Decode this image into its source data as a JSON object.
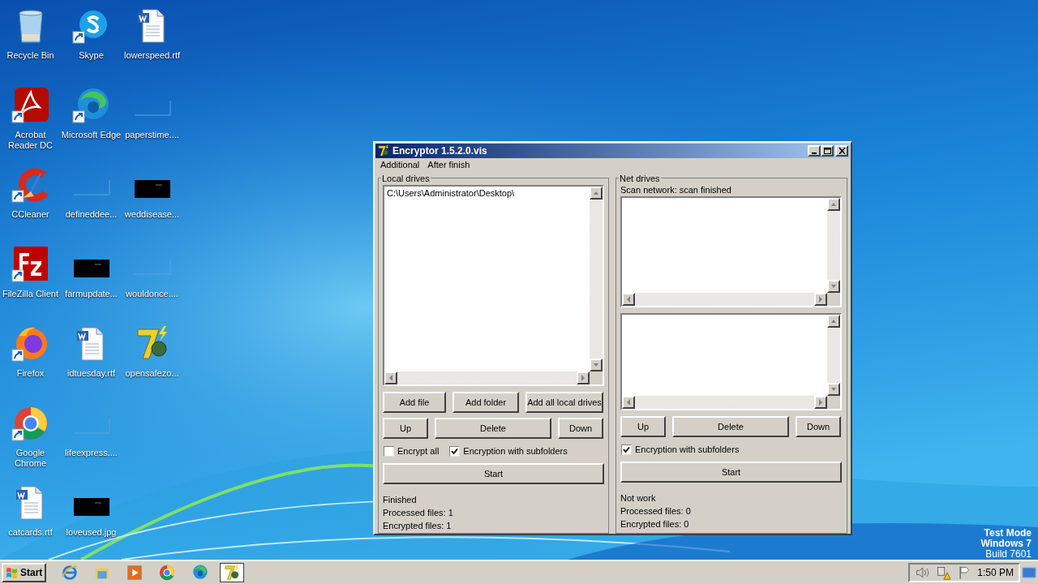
{
  "desktop_icons": [
    {
      "label": "Recycle Bin",
      "kind": "recycle",
      "shortcut": false
    },
    {
      "label": "Acrobat Reader DC",
      "kind": "acrobat",
      "shortcut": true
    },
    {
      "label": "CCleaner",
      "kind": "ccleaner",
      "shortcut": true
    },
    {
      "label": "FileZilla Client",
      "kind": "filezilla",
      "shortcut": true
    },
    {
      "label": "Firefox",
      "kind": "firefox",
      "shortcut": true
    },
    {
      "label": "Google Chrome",
      "kind": "chrome",
      "shortcut": true
    },
    {
      "label": "catcards.rtf",
      "kind": "document",
      "shortcut": false
    },
    {
      "label": "Skype",
      "kind": "skype",
      "shortcut": true
    },
    {
      "label": "Microsoft Edge",
      "kind": "edge",
      "shortcut": true
    },
    {
      "label": "defineddee...",
      "kind": "blank",
      "shortcut": false
    },
    {
      "label": "farmupdate...",
      "kind": "dark",
      "shortcut": false
    },
    {
      "label": "idtuesday.rtf",
      "kind": "document",
      "shortcut": false
    },
    {
      "label": "lifeexpress....",
      "kind": "blank",
      "shortcut": false
    },
    {
      "label": "loveused.jpg",
      "kind": "dark",
      "shortcut": false
    },
    {
      "label": "lowerspeed.rtf",
      "kind": "document",
      "shortcut": false
    },
    {
      "label": "paperstime....",
      "kind": "blank",
      "shortcut": false
    },
    {
      "label": "weddisease...",
      "kind": "dark",
      "shortcut": false
    },
    {
      "label": "wouldonce....",
      "kind": "blank",
      "shortcut": false
    },
    {
      "label": "opensafezo...",
      "kind": "seven",
      "shortcut": false
    }
  ],
  "window": {
    "title": "Encryptor 1.5.2.0.vis",
    "menu": [
      "Additional",
      "After finish"
    ],
    "local": {
      "title": "Local drives",
      "items": [
        "C:\\Users\\Administrator\\Desktop\\"
      ],
      "add_buttons": [
        "Add file",
        "Add folder",
        "Add all local drives"
      ],
      "order_buttons": [
        "Up",
        "Delete",
        "Down"
      ],
      "checkboxes": [
        {
          "label": "Encrypt all",
          "checked": false
        },
        {
          "label": "Encryption with subfolders",
          "checked": true
        }
      ],
      "start": "Start",
      "status": [
        "Finished",
        "Processed files: 1",
        "Encrypted files: 1"
      ]
    },
    "net": {
      "title": "Net drives",
      "scan_status": "Scan network: scan finished",
      "order_buttons": [
        "Up",
        "Delete",
        "Down"
      ],
      "checkboxes": [
        {
          "label": "Encryption with subfolders",
          "checked": true
        }
      ],
      "start": "Start",
      "status": [
        "Not work",
        "Processed files: 0",
        "Encrypted files: 0"
      ]
    }
  },
  "os_watermark": [
    {
      "text": "Test Mode",
      "bold": true
    },
    {
      "text": "Windows 7",
      "bold": true
    },
    {
      "text": "Build 7601",
      "bold": false
    }
  ],
  "taskbar": {
    "start": "Start",
    "apps": [
      {
        "kind": "ie",
        "active": false
      },
      {
        "kind": "explorer",
        "active": false
      },
      {
        "kind": "media",
        "active": false
      },
      {
        "kind": "chrome",
        "active": false
      },
      {
        "kind": "edge",
        "active": false
      },
      {
        "kind": "seven",
        "active": true
      }
    ],
    "tray": [
      {
        "kind": "speaker"
      },
      {
        "kind": "network"
      },
      {
        "kind": "flag"
      }
    ],
    "clock": "1:50 PM"
  }
}
